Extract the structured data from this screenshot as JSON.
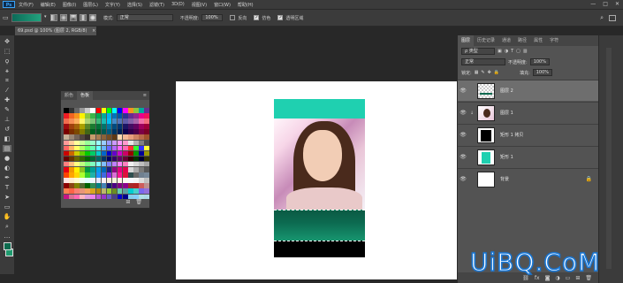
{
  "menubar": {
    "logo": "Ps",
    "items": [
      "文件(F)",
      "编辑(E)",
      "图像(I)",
      "图层(L)",
      "文字(Y)",
      "选择(S)",
      "滤镜(T)",
      "3D(D)",
      "视图(V)",
      "窗口(W)",
      "帮助(H)"
    ],
    "window_controls": [
      "—",
      "□",
      "✕"
    ]
  },
  "options": {
    "mode_label": "模式:",
    "mode_value": "正常",
    "opacity_label": "不透明度:",
    "opacity_value": "100%",
    "reverse_label": "反向",
    "dither_label": "仿色",
    "transparency_label": "透明区域"
  },
  "document": {
    "tab_title": "69.psd @ 100% (图层 2, RGB/8)",
    "close": "×"
  },
  "swatches_panel": {
    "tabs": [
      "颜色",
      "色板"
    ],
    "active_tab": "色板",
    "menu_icon": "≡",
    "footer_icons": [
      "new-swatch-icon",
      "trash-icon"
    ]
  },
  "swatch_colors": [
    "#000000",
    "#333333",
    "#666666",
    "#999999",
    "#cccccc",
    "#ffffff",
    "#ff0000",
    "#ffff00",
    "#00ff00",
    "#00ffff",
    "#0000ff",
    "#ff00ff",
    "#f7941d",
    "#8dc63f",
    "#00a99d",
    "#662d91",
    "#ed1c24",
    "#f26522",
    "#f7941d",
    "#fff200",
    "#8dc73f",
    "#39b54a",
    "#00a651",
    "#00a99d",
    "#00aeef",
    "#0072bc",
    "#0054a6",
    "#2e3192",
    "#662d91",
    "#92278f",
    "#ec008c",
    "#ed145b",
    "#f26c4f",
    "#f68e56",
    "#fbaf5d",
    "#fff568",
    "#acd373",
    "#7cc576",
    "#3bb878",
    "#1abbb4",
    "#00bff3",
    "#438cca",
    "#5574b9",
    "#605ca8",
    "#8560a8",
    "#a864a8",
    "#f06eaa",
    "#f26d7d",
    "#9e0b0f",
    "#a0410d",
    "#a3620a",
    "#aba000",
    "#598527",
    "#197b30",
    "#007236",
    "#00746b",
    "#0076a3",
    "#004b80",
    "#003471",
    "#1b1464",
    "#440e62",
    "#630460",
    "#9e005d",
    "#9e0039",
    "#790000",
    "#7b2e00",
    "#7d4900",
    "#827b00",
    "#406618",
    "#005e20",
    "#005826",
    "#005952",
    "#005b7f",
    "#003663",
    "#002157",
    "#0d004c",
    "#32004b",
    "#4b0049",
    "#7b0046",
    "#7a0026",
    "#c7b299",
    "#998675",
    "#736357",
    "#534741",
    "#37302a",
    "#c69c6d",
    "#a67c52",
    "#8c6239",
    "#754c24",
    "#603913",
    "#ffd8b1",
    "#f5b895",
    "#e79f7e",
    "#ce8363",
    "#b9694a",
    "#a0522d",
    "#ff9999",
    "#ffcc99",
    "#ffff99",
    "#ccff99",
    "#99ff99",
    "#99ffcc",
    "#99ffff",
    "#99ccff",
    "#9999ff",
    "#cc99ff",
    "#ff99ff",
    "#ff99cc",
    "#e6e6e6",
    "#b3b3b3",
    "#808080",
    "#4d4d4d",
    "#ff6666",
    "#ffb366",
    "#ffff66",
    "#b3ff66",
    "#66ff66",
    "#66ffb3",
    "#66ffff",
    "#66b3ff",
    "#6666ff",
    "#b366ff",
    "#ff66ff",
    "#ff66b3",
    "#ff3333",
    "#33ff33",
    "#3333ff",
    "#ffff33",
    "#cc0000",
    "#cc6600",
    "#cccc00",
    "#66cc00",
    "#00cc00",
    "#00cc66",
    "#00cccc",
    "#0066cc",
    "#0000cc",
    "#6600cc",
    "#cc00cc",
    "#cc0066",
    "#990000",
    "#009900",
    "#000099",
    "#999900",
    "#660000",
    "#663300",
    "#666600",
    "#336600",
    "#006600",
    "#006633",
    "#006666",
    "#003366",
    "#000066",
    "#330066",
    "#660066",
    "#660033",
    "#330000",
    "#003300",
    "#000033",
    "#333300",
    "#ff8080",
    "#ffbf80",
    "#ffff80",
    "#bfff80",
    "#80ff80",
    "#80ffbf",
    "#80ffff",
    "#80bfff",
    "#8080ff",
    "#bf80ff",
    "#ff80ff",
    "#ff80bf",
    "#f0f0f0",
    "#d9d9d9",
    "#bfbfbf",
    "#a6a6a6",
    "#e60012",
    "#f39800",
    "#fff100",
    "#8fc31f",
    "#009944",
    "#009e96",
    "#00a0e9",
    "#0068b7",
    "#1d2088",
    "#920783",
    "#e4007f",
    "#e5004f",
    "#d6d6d6",
    "#aaaaaa",
    "#7a7a7a",
    "#575757",
    "#ff4500",
    "#ffa500",
    "#ffd700",
    "#adff2f",
    "#32cd32",
    "#20b2aa",
    "#1e90ff",
    "#4169e1",
    "#8a2be2",
    "#da70d6",
    "#ff1493",
    "#dc143c",
    "#2f4f4f",
    "#696969",
    "#708090",
    "#778899",
    "#ffe4e1",
    "#ffebcd",
    "#fffacd",
    "#f0fff0",
    "#e0ffff",
    "#f0f8ff",
    "#e6e6fa",
    "#fff0f5",
    "#faebd7",
    "#f5f5dc",
    "#fdf5e6",
    "#fffaf0",
    "#f8f8ff",
    "#f5f5f5",
    "#dcdcdc",
    "#c0c0c0",
    "#8b0000",
    "#8b4513",
    "#808000",
    "#556b2f",
    "#006400",
    "#2e8b57",
    "#008080",
    "#4682b4",
    "#191970",
    "#4b0082",
    "#800080",
    "#8b008b",
    "#a52a2a",
    "#b22222",
    "#cd5c5c",
    "#bc8f8f",
    "#ff7f50",
    "#ff6347",
    "#fa8072",
    "#e9967a",
    "#f4a460",
    "#daa520",
    "#b8860b",
    "#bdb76b",
    "#9acd32",
    "#6b8e23",
    "#66cdaa",
    "#5f9ea0",
    "#00ced1",
    "#48d1cc",
    "#7b68ee",
    "#9370db",
    "#c71585",
    "#db7093",
    "#ff69b4",
    "#ffb6c1",
    "#dda0dd",
    "#ee82ee",
    "#ba55d3",
    "#9932cc",
    "#6a5acd",
    "#483d8b",
    "#0000cd",
    "#00008b",
    "#87ceeb",
    "#87cefa",
    "#b0e0e6",
    "#add8e6"
  ],
  "layers_panel": {
    "tabs": [
      "图层",
      "历史记录",
      "通道",
      "路径",
      "属性",
      "字符"
    ],
    "active_tab": "图层",
    "kind_label": "ρ 类型",
    "blend_mode": "正常",
    "opacity_label": "不透明度:",
    "opacity_value": "100%",
    "lock_label": "锁定:",
    "fill_label": "填充:",
    "fill_value": "100%",
    "layers": [
      {
        "name": "图层 2",
        "selected": true,
        "thumb": "green-gradient"
      },
      {
        "name": "图层 1",
        "selected": false,
        "thumb": "photo",
        "clipped": true
      },
      {
        "name": "矩形 1 拷贝",
        "selected": false,
        "thumb": "black-rect"
      },
      {
        "name": "矩形 1",
        "selected": false,
        "thumb": "teal-rect"
      },
      {
        "name": "背景",
        "selected": false,
        "thumb": "white",
        "locked": true
      }
    ],
    "footer_icons": [
      "link-icon",
      "fx-icon",
      "mask-icon",
      "adjustment-icon",
      "folder-icon",
      "new-layer-icon",
      "trash-icon"
    ]
  },
  "watermark": "UiBQ.CoM"
}
